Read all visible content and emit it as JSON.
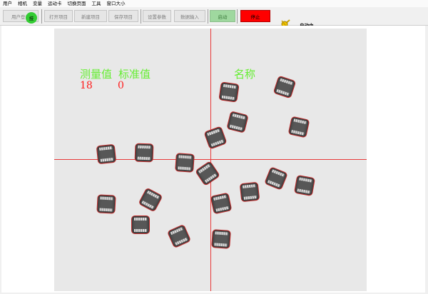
{
  "menu": [
    "用户",
    "相机",
    "变量",
    "运动卡",
    "切换页面",
    "工具",
    "窗口大小"
  ],
  "toolbar": {
    "login": "用户登录",
    "indicator": "技",
    "open_project": "打开项目",
    "new_project": "新建项目",
    "save_project": "保存项目",
    "settings": "设置参数",
    "data_input": "数据输入",
    "start": "启动",
    "stop": "停止",
    "status": "自动中"
  },
  "overlay": {
    "measured_label": "测量值",
    "measured_value": "18",
    "standard_label": "标准值",
    "standard_value": "0",
    "name_label": "名称"
  },
  "image_view": {
    "part_count": 18
  }
}
